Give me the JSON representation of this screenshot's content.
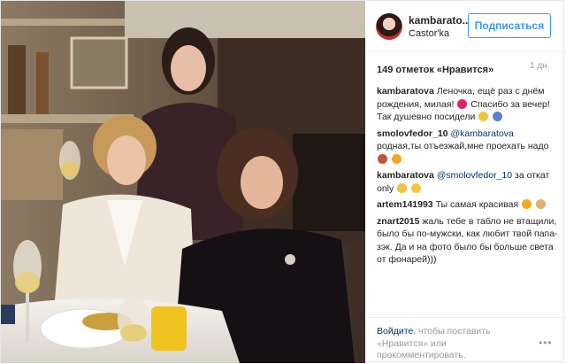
{
  "header": {
    "username": "kambarato...",
    "location": "Castor'ka",
    "follow_label": "Подписаться"
  },
  "post": {
    "likes": "149 отметок «Нравится»",
    "time": "1 дн."
  },
  "comments": [
    {
      "user": "kambaratova",
      "text": "Леночка, ещё раз с днём рождения, милая!",
      "text2": "Спасибо за вечер! Так душевно посидели"
    },
    {
      "user": "smolovfedor_10",
      "mention": "@kambaratova",
      "text": "родная,ты отъезжай,мне проехать надо"
    },
    {
      "user": "kambaratova",
      "mention": "@smolovfedor_10",
      "text": "за откат only"
    },
    {
      "user": "artem141993",
      "text": "Ты самая красивая"
    },
    {
      "user": "znart2015",
      "text": "жаль тебе в табло не втащили, было бы по-мужски, как любит твой папа-зэк. Да и на фото было бы больше света от фонарей)))"
    }
  ],
  "footer": {
    "login_link": "Войдите",
    "login_text": ", чтобы поставить «Нравится» или прокомментировать.",
    "more_icon": "•••"
  },
  "colors": {
    "accent": "#3897f0",
    "link": "#003569",
    "text": "#262626",
    "muted": "#999999"
  }
}
